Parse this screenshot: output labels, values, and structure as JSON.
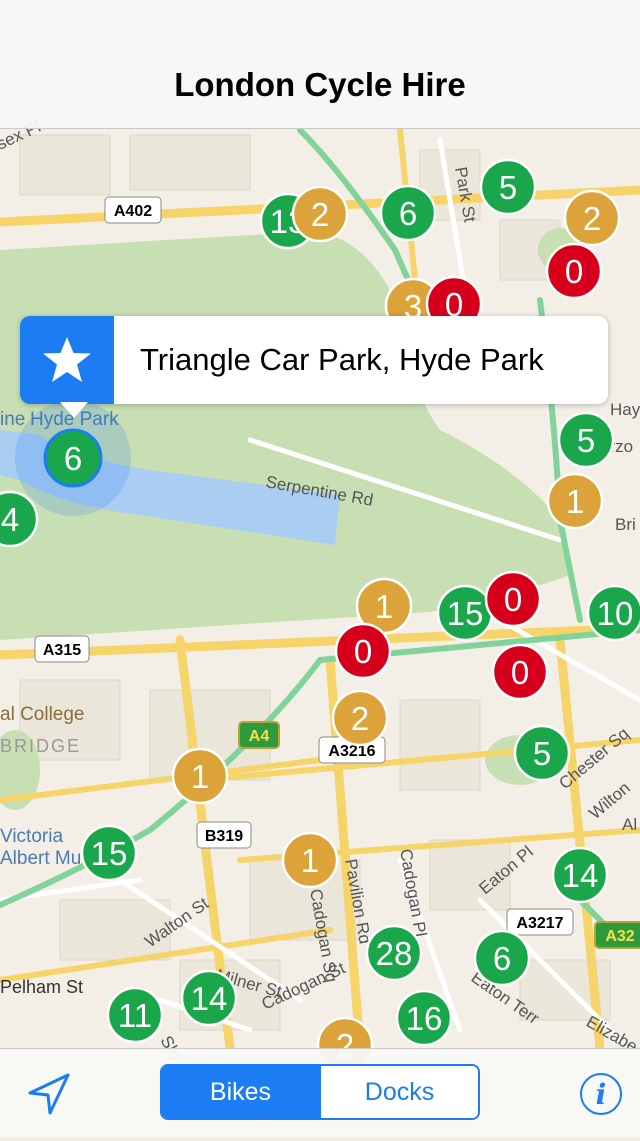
{
  "nav": {
    "title": "London Cycle Hire"
  },
  "callout": {
    "text": "Triangle Car Park, Hyde Park",
    "icon": "star-icon"
  },
  "toolbar": {
    "locate_icon": "location-arrow-icon",
    "segments": [
      {
        "label": "Bikes",
        "selected": true
      },
      {
        "label": "Docks",
        "selected": false
      }
    ],
    "info_icon": "info-icon",
    "info_label": "i"
  },
  "colors": {
    "accent": "#1c7cf4",
    "available": "#1aa64a",
    "low": "#dba33a",
    "empty": "#d6001c",
    "park": "#c8dfb3",
    "water": "#aacdf2"
  },
  "road_labels": [
    "A402",
    "A315",
    "A4",
    "A3216",
    "B319",
    "A3217",
    "A32"
  ],
  "street_labels": [
    "Serpentine Rd",
    "Park St",
    "Walton St",
    "Pelham St",
    "Cadogan Pl",
    "Cadogan St",
    "Pavilion Rd",
    "Eaton Pl",
    "Eaton Terr",
    "Chester Sq",
    "Wilton",
    "Elizabe",
    "Milner St",
    "Hyde Park",
    "Victoria",
    "Albert Muse",
    "al College",
    "BRIDGE",
    "Slo",
    "Cadogan Sq",
    "Bri",
    "Hay",
    "arzo",
    "sex Pl",
    "ine",
    "Al"
  ],
  "stations": [
    {
      "count": "6",
      "status": "selected"
    },
    {
      "count": "13",
      "status": "available"
    },
    {
      "count": "2",
      "status": "low"
    },
    {
      "count": "6",
      "status": "available"
    },
    {
      "count": "5",
      "status": "available"
    },
    {
      "count": "2",
      "status": "low"
    },
    {
      "count": "0",
      "status": "empty"
    },
    {
      "count": "3",
      "status": "low"
    },
    {
      "count": "0",
      "status": "empty"
    },
    {
      "count": "5",
      "status": "available"
    },
    {
      "count": "1",
      "status": "low"
    },
    {
      "count": "4",
      "status": "available"
    },
    {
      "count": "1",
      "status": "low"
    },
    {
      "count": "15",
      "status": "available"
    },
    {
      "count": "0",
      "status": "empty"
    },
    {
      "count": "10",
      "status": "available"
    },
    {
      "count": "0",
      "status": "empty"
    },
    {
      "count": "0",
      "status": "empty"
    },
    {
      "count": "2",
      "status": "low"
    },
    {
      "count": "5",
      "status": "available"
    },
    {
      "count": "1",
      "status": "low"
    },
    {
      "count": "15",
      "status": "available"
    },
    {
      "count": "1",
      "status": "low"
    },
    {
      "count": "14",
      "status": "available"
    },
    {
      "count": "28",
      "status": "available"
    },
    {
      "count": "6",
      "status": "available"
    },
    {
      "count": "11",
      "status": "available"
    },
    {
      "count": "14",
      "status": "available"
    },
    {
      "count": "16",
      "status": "available"
    },
    {
      "count": "2",
      "status": "low"
    }
  ]
}
